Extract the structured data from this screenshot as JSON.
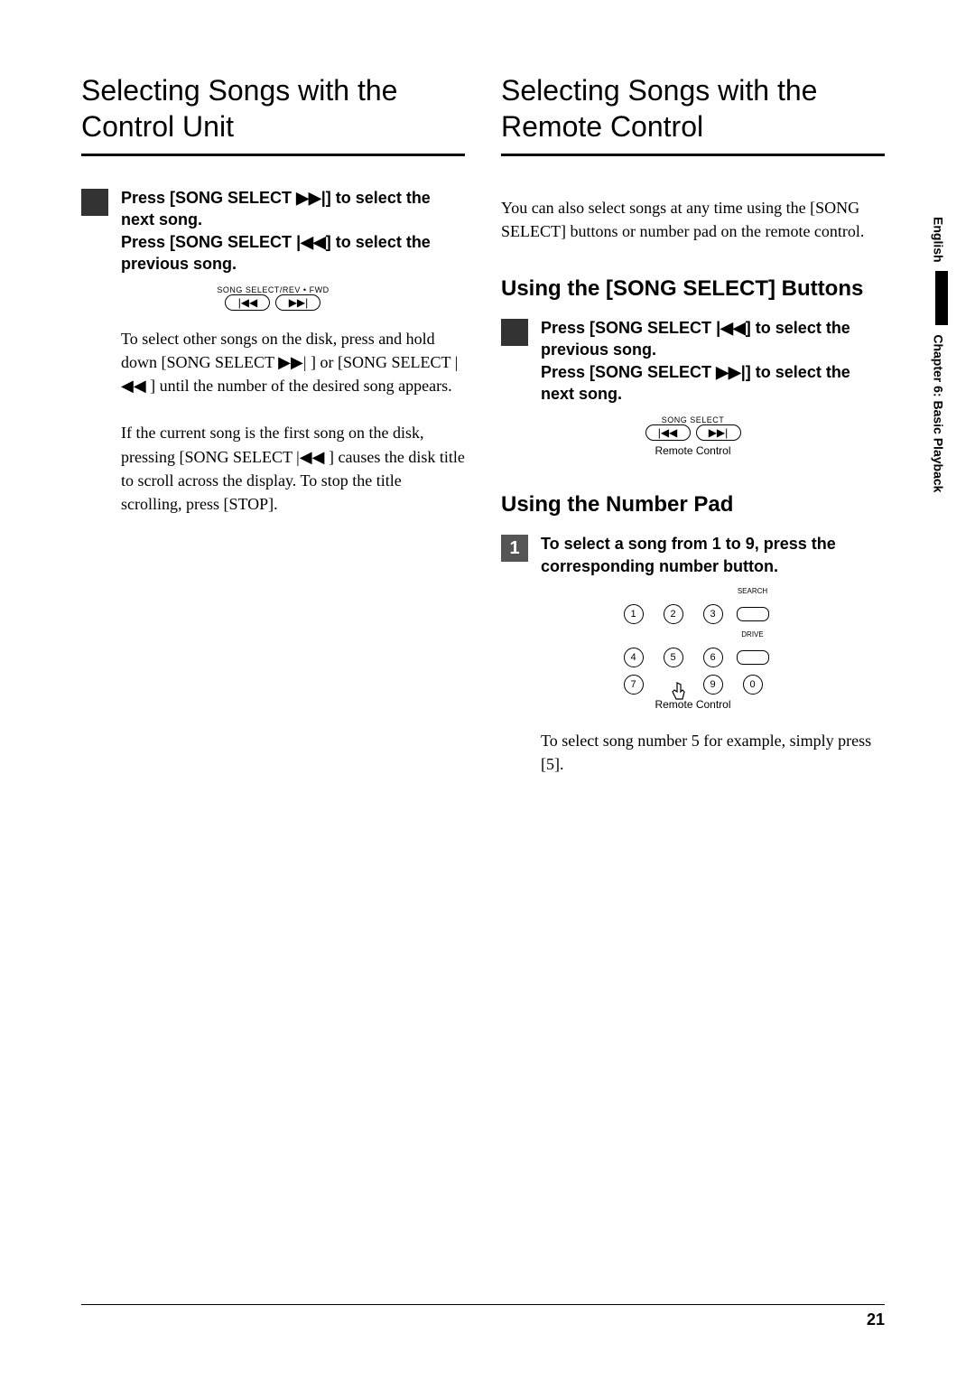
{
  "left": {
    "heading": "Selecting Songs with the Control Unit",
    "step_line_1a": "Press [SONG SELECT ",
    "step_line_1b": "] to select the next song.",
    "step_line_2a": "Press [SONG SELECT ",
    "step_line_2b": "] to select the previous song.",
    "diagram_top_label": "SONG SELECT/REV • FWD",
    "para1": "To select other songs on the disk, press and hold down [SONG SELECT ▶▶| ] or [SONG SELECT |◀◀ ] until the number of the desired song appears.",
    "para2": "If the current song is the first song on the disk, pressing [SONG SELECT |◀◀ ] causes the disk title to scroll across the display. To stop the title scrolling, press [STOP]."
  },
  "right": {
    "heading": "Selecting Songs with the Remote Control",
    "intro": "You can also select songs at any time using the [SONG SELECT] buttons or number pad on the remote control.",
    "subhead1": "Using the [SONG SELECT] Buttons",
    "step1_1a": "Press [SONG SELECT ",
    "step1_1b": "] to select the previous song.",
    "step1_2a": "Press [SONG SELECT ",
    "step1_2b": "] to select the next song.",
    "diagram1_top_label": "SONG SELECT",
    "diagram1_caption": "Remote Control",
    "subhead2": "Using the Number Pad",
    "step2_num": "1",
    "step2_text": "To select a song from 1 to 9, press the corresponding number button.",
    "numpad_labels": {
      "search": "SEARCH",
      "drive": "DRIVE"
    },
    "numpad_caption": "Remote Control",
    "para_after": "To select song number 5 for example, simply press [5]."
  },
  "side": {
    "lang": "English",
    "chap": "Chapter 6:  Basic Playback"
  },
  "icons": {
    "fwd": "▶▶|",
    "rev": "|◀◀"
  },
  "page_number": "21"
}
